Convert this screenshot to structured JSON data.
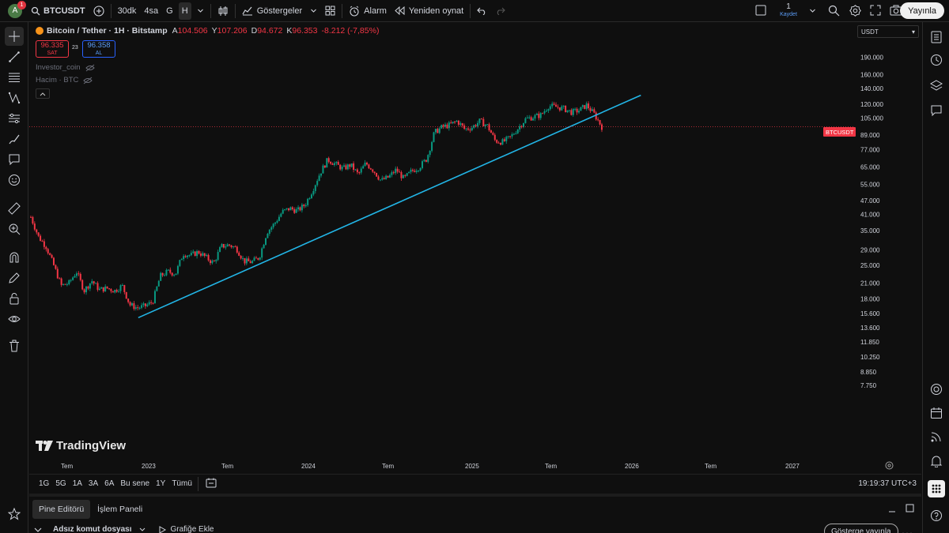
{
  "topbar": {
    "avatar_letter": "A",
    "notification_count": "1",
    "symbol": "BTCUSDT",
    "intervals": [
      "30dk",
      "4sa",
      "G",
      "H"
    ],
    "active_interval": "H",
    "indicators_label": "Göstergeler",
    "alarm_label": "Alarm",
    "replay_label": "Yeniden oynat",
    "save_count": "1",
    "save_label": "Kaydet",
    "publish_label": "Yayınla"
  },
  "legend": {
    "title": "Bitcoin / Tether · 1H · Bitstamp",
    "open_key": "A",
    "open": "104.506",
    "high_key": "Y",
    "high": "107.206",
    "low_key": "D",
    "low": "94.672",
    "close_key": "K",
    "close": "96.353",
    "change": "-8.212 (-7,85%)",
    "sell_price": "96.335",
    "sell_label": "SAT",
    "spread": "23",
    "buy_price": "96.358",
    "buy_label": "AL",
    "indicator1": "Investor_coin",
    "indicator2": "Hacim · BTC"
  },
  "currency": "USDT",
  "brand": "TradingView",
  "current_price_tag": "BTCUSDT",
  "colors": {
    "up": "#089981",
    "down": "#f23645",
    "trendline": "#22b5e6",
    "background": "#0f0f0f"
  },
  "chart_data": {
    "type": "candlestick",
    "scale": "log",
    "price_axis": [
      "190.000",
      "160.000",
      "140.000",
      "120.000",
      "105.000",
      "89.000",
      "77.000",
      "65.000",
      "55.000",
      "47.000",
      "41.000",
      "35.000",
      "29.000",
      "25.000",
      "21.000",
      "18.000",
      "15.600",
      "13.600",
      "11.850",
      "10.250",
      "8.850",
      "7.750"
    ],
    "time_axis": [
      "Tem",
      "2023",
      "Tem",
      "2024",
      "Tem",
      "2025",
      "Tem",
      "2026",
      "Tem",
      "2027"
    ],
    "ylim": [
      7000,
      200000
    ],
    "close_path": [
      [
        0,
        40000
      ],
      [
        1,
        33000
      ],
      [
        2,
        30000
      ],
      [
        3,
        25000
      ],
      [
        4,
        20500
      ],
      [
        5,
        21000
      ],
      [
        6,
        23500
      ],
      [
        7,
        19500
      ],
      [
        8,
        21500
      ],
      [
        9,
        19700
      ],
      [
        10,
        20000
      ],
      [
        11,
        19500
      ],
      [
        12,
        20500
      ],
      [
        13,
        17000
      ],
      [
        14,
        16500
      ],
      [
        15,
        16800
      ],
      [
        16,
        17500
      ],
      [
        17,
        22500
      ],
      [
        18,
        23500
      ],
      [
        19,
        23000
      ],
      [
        20,
        28000
      ],
      [
        21,
        27500
      ],
      [
        22,
        28500
      ],
      [
        23,
        27000
      ],
      [
        24,
        25500
      ],
      [
        25,
        30000
      ],
      [
        26,
        30500
      ],
      [
        27,
        29500
      ],
      [
        28,
        26000
      ],
      [
        29,
        25800
      ],
      [
        30,
        27000
      ],
      [
        31,
        34500
      ],
      [
        32,
        37500
      ],
      [
        33,
        42000
      ],
      [
        34,
        43500
      ],
      [
        35,
        42500
      ],
      [
        36,
        45000
      ],
      [
        37,
        52000
      ],
      [
        38,
        61500
      ],
      [
        39,
        70000
      ],
      [
        40,
        67000
      ],
      [
        41,
        64000
      ],
      [
        42,
        66500
      ],
      [
        43,
        60500
      ],
      [
        44,
        67500
      ],
      [
        45,
        63000
      ],
      [
        46,
        57000
      ],
      [
        47,
        59000
      ],
      [
        48,
        63500
      ],
      [
        49,
        58000
      ],
      [
        50,
        62500
      ],
      [
        51,
        65000
      ],
      [
        52,
        70500
      ],
      [
        53,
        91000
      ],
      [
        54,
        96000
      ],
      [
        55,
        98000
      ],
      [
        56,
        102000
      ],
      [
        57,
        94000
      ],
      [
        58,
        96000
      ],
      [
        59,
        102000
      ],
      [
        60,
        97000
      ],
      [
        61,
        84000
      ],
      [
        62,
        83000
      ],
      [
        63,
        87000
      ],
      [
        64,
        95000
      ],
      [
        65,
        104000
      ],
      [
        66,
        106000
      ],
      [
        67,
        108000
      ],
      [
        68,
        118000
      ],
      [
        69,
        117000
      ],
      [
        70,
        115000
      ],
      [
        71,
        111000
      ],
      [
        72,
        113000
      ],
      [
        73,
        119000
      ],
      [
        74,
        109000
      ],
      [
        75,
        96353
      ]
    ],
    "trendline": [
      [
        2022.97,
        15000
      ],
      [
        2026.07,
        131000
      ]
    ]
  },
  "timebar": {
    "ranges": [
      "1G",
      "5G",
      "1A",
      "3A",
      "6A",
      "Bu sene",
      "1Y",
      "Tümü"
    ],
    "clock": "19:19:37 UTC+3"
  },
  "bottom": {
    "tab_pine": "Pine Editörü",
    "tab_trade": "İşlem Paneli",
    "script_name": "Adsız komut dosyası",
    "add_to_chart": "Grafiğe Ekle",
    "publish_indicator": "Gösterge yayınla"
  }
}
